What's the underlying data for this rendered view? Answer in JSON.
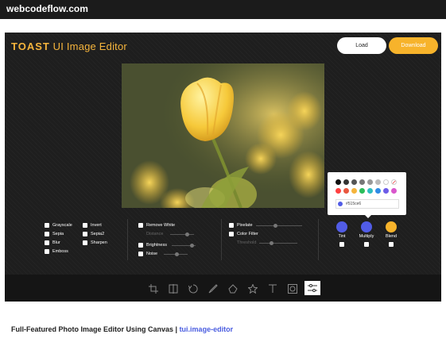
{
  "site": {
    "name": "webcodeflow.com"
  },
  "editor": {
    "logo_bold": "TOAST",
    "logo_rest": "UI Image Editor",
    "load_label": "Load",
    "download_label": "Download"
  },
  "palette": {
    "row1": [
      "#111111",
      "#333333",
      "#555555",
      "#777777",
      "#999999",
      "#bbbbbb",
      "#ffffff",
      "transparent"
    ],
    "row2": [
      "#ff4040",
      "#e9573f",
      "#f5b43c",
      "#2bbd5a",
      "#2ebdc1",
      "#2e8be6",
      "#6d5ce8",
      "#d957cc"
    ],
    "hex_value": "#515ce6"
  },
  "filters": {
    "col1": [
      "Grayscale",
      "Sepia",
      "Blur",
      "Emboss"
    ],
    "col2": [
      "Invert",
      "Sepia2",
      "Sharpen"
    ],
    "col3": {
      "remove_white": "Remove White",
      "distance": "Distance",
      "brightness": "Brightness",
      "noise": "Noise"
    },
    "col4": {
      "pixelate": "Pixelate",
      "color_filter": "Color Filter",
      "threshold": "Threshold"
    },
    "col5": {
      "tint": "Tint",
      "multiply": "Multiply",
      "blend": "Blend"
    }
  },
  "colors": {
    "tint": "#515ce6",
    "multiply": "#515ce6",
    "blend": "#f7b32b",
    "accent": "#f7b32b"
  },
  "toolbar": {
    "icons": [
      "crop-icon",
      "flip-icon",
      "rotate-icon",
      "draw-icon",
      "shape-icon",
      "icon-icon",
      "text-icon",
      "mask-icon",
      "filter-icon"
    ],
    "active": "filter-icon"
  },
  "caption": {
    "title": "Full-Featured Photo Image Editor Using Canvas",
    "divider": " | ",
    "link": "tui.image-editor"
  }
}
